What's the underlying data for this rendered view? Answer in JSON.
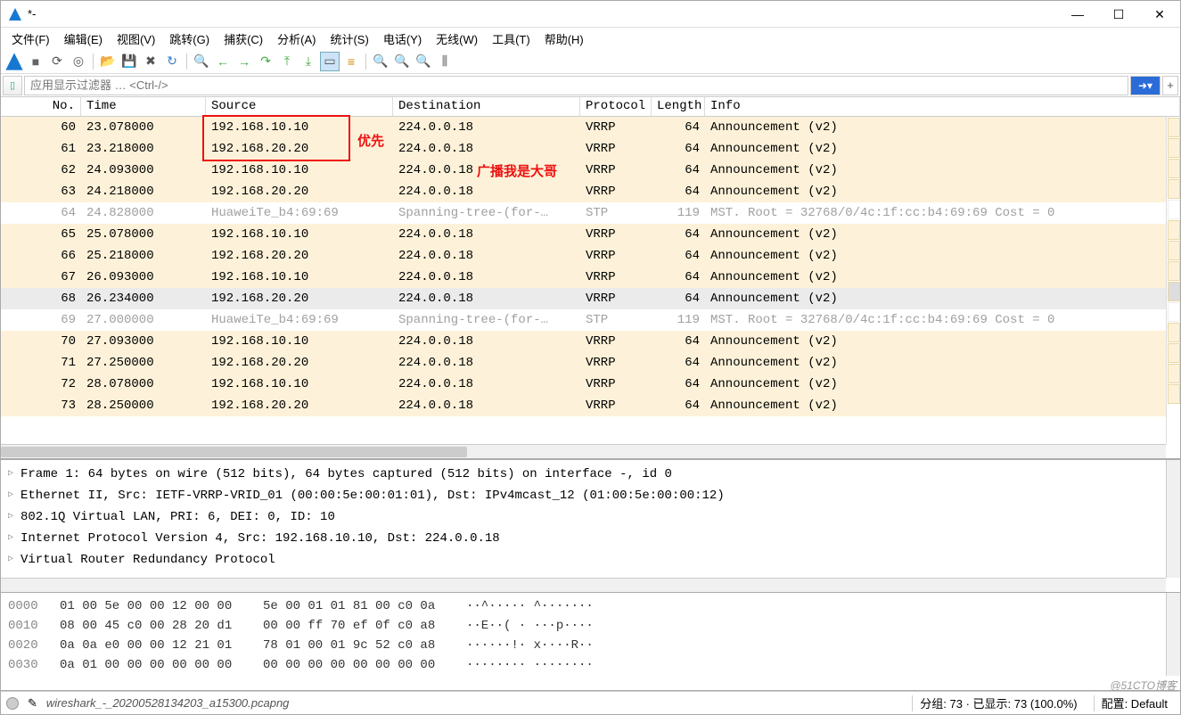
{
  "title": "*-",
  "menus": [
    "文件(F)",
    "编辑(E)",
    "视图(V)",
    "跳转(G)",
    "捕获(C)",
    "分析(A)",
    "统计(S)",
    "电话(Y)",
    "无线(W)",
    "工具(T)",
    "帮助(H)"
  ],
  "filter_placeholder": "应用显示过滤器 … <Ctrl-/>",
  "columns": {
    "no": "No.",
    "time": "Time",
    "src": "Source",
    "dst": "Destination",
    "proto": "Protocol",
    "len": "Length",
    "info": "Info"
  },
  "annotations": {
    "priority": "优先",
    "broadcast": "广播我是大哥"
  },
  "packets": [
    {
      "no": 60,
      "time": "23.078000",
      "src": "192.168.10.10",
      "dst": "224.0.0.18",
      "proto": "VRRP",
      "len": 64,
      "info": "Announcement (v2)",
      "cls": "c-vrrp"
    },
    {
      "no": 61,
      "time": "23.218000",
      "src": "192.168.20.20",
      "dst": "224.0.0.18",
      "proto": "VRRP",
      "len": 64,
      "info": "Announcement (v2)",
      "cls": "c-vrrp"
    },
    {
      "no": 62,
      "time": "24.093000",
      "src": "192.168.10.10",
      "dst": "224.0.0.18",
      "proto": "VRRP",
      "len": 64,
      "info": "Announcement (v2)",
      "cls": "c-vrrp"
    },
    {
      "no": 63,
      "time": "24.218000",
      "src": "192.168.20.20",
      "dst": "224.0.0.18",
      "proto": "VRRP",
      "len": 64,
      "info": "Announcement (v2)",
      "cls": "c-vrrp"
    },
    {
      "no": 64,
      "time": "24.828000",
      "src": "HuaweiTe_b4:69:69",
      "dst": "Spanning-tree-(for-…",
      "proto": "STP",
      "len": 119,
      "info": "MST. Root = 32768/0/4c:1f:cc:b4:69:69  Cost = 0",
      "cls": "c-stp"
    },
    {
      "no": 65,
      "time": "25.078000",
      "src": "192.168.10.10",
      "dst": "224.0.0.18",
      "proto": "VRRP",
      "len": 64,
      "info": "Announcement (v2)",
      "cls": "c-vrrp"
    },
    {
      "no": 66,
      "time": "25.218000",
      "src": "192.168.20.20",
      "dst": "224.0.0.18",
      "proto": "VRRP",
      "len": 64,
      "info": "Announcement (v2)",
      "cls": "c-vrrp"
    },
    {
      "no": 67,
      "time": "26.093000",
      "src": "192.168.10.10",
      "dst": "224.0.0.18",
      "proto": "VRRP",
      "len": 64,
      "info": "Announcement (v2)",
      "cls": "c-vrrp"
    },
    {
      "no": 68,
      "time": "26.234000",
      "src": "192.168.20.20",
      "dst": "224.0.0.18",
      "proto": "VRRP",
      "len": 64,
      "info": "Announcement (v2)",
      "cls": "c-sel"
    },
    {
      "no": 69,
      "time": "27.000000",
      "src": "HuaweiTe_b4:69:69",
      "dst": "Spanning-tree-(for-…",
      "proto": "STP",
      "len": 119,
      "info": "MST. Root = 32768/0/4c:1f:cc:b4:69:69  Cost = 0",
      "cls": "c-stp"
    },
    {
      "no": 70,
      "time": "27.093000",
      "src": "192.168.10.10",
      "dst": "224.0.0.18",
      "proto": "VRRP",
      "len": 64,
      "info": "Announcement (v2)",
      "cls": "c-vrrp"
    },
    {
      "no": 71,
      "time": "27.250000",
      "src": "192.168.20.20",
      "dst": "224.0.0.18",
      "proto": "VRRP",
      "len": 64,
      "info": "Announcement (v2)",
      "cls": "c-vrrp"
    },
    {
      "no": 72,
      "time": "28.078000",
      "src": "192.168.10.10",
      "dst": "224.0.0.18",
      "proto": "VRRP",
      "len": 64,
      "info": "Announcement (v2)",
      "cls": "c-vrrp"
    },
    {
      "no": 73,
      "time": "28.250000",
      "src": "192.168.20.20",
      "dst": "224.0.0.18",
      "proto": "VRRP",
      "len": 64,
      "info": "Announcement (v2)",
      "cls": "c-vrrp"
    }
  ],
  "details": [
    "Frame 1: 64 bytes on wire (512 bits), 64 bytes captured (512 bits) on interface -, id 0",
    "Ethernet II, Src: IETF-VRRP-VRID_01 (00:00:5e:00:01:01), Dst: IPv4mcast_12 (01:00:5e:00:00:12)",
    "802.1Q Virtual LAN, PRI: 6, DEI: 0, ID: 10",
    "Internet Protocol Version 4, Src: 192.168.10.10, Dst: 224.0.0.18",
    "Virtual Router Redundancy Protocol"
  ],
  "hex": [
    {
      "off": "0000",
      "g1": "01 00 5e 00 00 12 00 00",
      "g2": "5e 00 01 01 81 00 c0 0a",
      "asc": "··^····· ^·······"
    },
    {
      "off": "0010",
      "g1": "08 00 45 c0 00 28 20 d1",
      "g2": "00 00 ff 70 ef 0f c0 a8",
      "asc": "··E··( · ···p····"
    },
    {
      "off": "0020",
      "g1": "0a 0a e0 00 00 12 21 01",
      "g2": "78 01 00 01 9c 52 c0 a8",
      "asc": "······!· x····R··"
    },
    {
      "off": "0030",
      "g1": "0a 01 00 00 00 00 00 00",
      "g2": "00 00 00 00 00 00 00 00",
      "asc": "········ ········"
    }
  ],
  "status": {
    "file": "wireshark_-_20200528134203_a15300.pcapng",
    "packets": "分组: 73 · 已显示: 73 (100.0%)",
    "profile": "配置: Default"
  },
  "credit": "@51CTO博客"
}
